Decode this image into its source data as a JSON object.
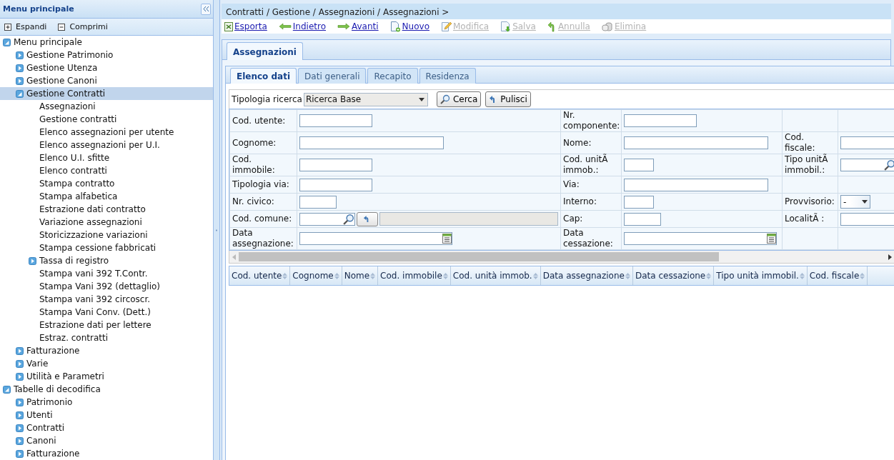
{
  "sidebar": {
    "title": "Menu principale",
    "actions": [
      {
        "label": "Espandi",
        "kind": "expand"
      },
      {
        "label": "Comprimi",
        "kind": "collapse"
      }
    ],
    "tree": [
      {
        "label": "Menu principale",
        "kind": "folder",
        "expanded": true,
        "selected": false,
        "children": [
          {
            "label": "Gestione Patrimonio",
            "kind": "folder",
            "expanded": false,
            "selected": false
          },
          {
            "label": "Gestione Utenza",
            "kind": "folder",
            "expanded": false,
            "selected": false
          },
          {
            "label": "Gestione Canoni",
            "kind": "folder",
            "expanded": false,
            "selected": false
          },
          {
            "label": "Gestione Contratti",
            "kind": "folder",
            "expanded": true,
            "selected": true,
            "children": [
              {
                "label": "Assegnazioni",
                "kind": "leaf",
                "selected": false
              },
              {
                "label": "Gestione contratti",
                "kind": "leaf",
                "selected": false
              },
              {
                "label": "Elenco assegnazioni per utente",
                "kind": "leaf",
                "selected": false
              },
              {
                "label": "Elenco assegnazioni per U.I.",
                "kind": "leaf",
                "selected": false
              },
              {
                "label": "Elenco U.I. sfitte",
                "kind": "leaf",
                "selected": false
              },
              {
                "label": "Elenco contratti",
                "kind": "leaf",
                "selected": false
              },
              {
                "label": "Stampa contratto",
                "kind": "leaf",
                "selected": false
              },
              {
                "label": "Stampa alfabetica",
                "kind": "leaf",
                "selected": false
              },
              {
                "label": "Estrazione dati contratto",
                "kind": "leaf",
                "selected": false
              },
              {
                "label": "Variazione assegnazioni",
                "kind": "leaf",
                "selected": false
              },
              {
                "label": "Storicizzazione variazioni",
                "kind": "leaf",
                "selected": false
              },
              {
                "label": "Stampa cessione fabbricati",
                "kind": "leaf",
                "selected": false
              },
              {
                "label": "Tassa di registro",
                "kind": "folder",
                "expanded": false,
                "selected": false
              },
              {
                "label": "Stampa vani 392 T.Contr.",
                "kind": "leaf",
                "selected": false
              },
              {
                "label": "Stampa Vani 392 (dettaglio)",
                "kind": "leaf",
                "selected": false
              },
              {
                "label": "Stampa vani 392 circoscr.",
                "kind": "leaf",
                "selected": false
              },
              {
                "label": "Stampa Vani Conv. (Dett.)",
                "kind": "leaf",
                "selected": false
              },
              {
                "label": "Estrazione dati per lettere",
                "kind": "leaf",
                "selected": false
              },
              {
                "label": "Estraz. contratti",
                "kind": "leaf",
                "selected": false
              }
            ]
          },
          {
            "label": "Fatturazione",
            "kind": "folder",
            "expanded": false,
            "selected": false
          },
          {
            "label": "Varie",
            "kind": "folder",
            "expanded": false,
            "selected": false
          },
          {
            "label": "Utilità e Parametri",
            "kind": "folder",
            "expanded": false,
            "selected": false
          }
        ]
      },
      {
        "label": "Tabelle di decodifica",
        "kind": "folder",
        "expanded": true,
        "selected": false,
        "children": [
          {
            "label": "Patrimonio",
            "kind": "folder",
            "expanded": false,
            "selected": false
          },
          {
            "label": "Utenti",
            "kind": "folder",
            "expanded": false,
            "selected": false
          },
          {
            "label": "Contratti",
            "kind": "folder",
            "expanded": false,
            "selected": false
          },
          {
            "label": "Canoni",
            "kind": "folder",
            "expanded": false,
            "selected": false
          },
          {
            "label": "Fatturazione",
            "kind": "folder",
            "expanded": false,
            "selected": false
          }
        ]
      }
    ]
  },
  "breadcrumb": "Contratti / Gestione / Assegnazioni / Assegnazioni >",
  "toolbar": [
    {
      "label": "Esporta",
      "kind": "export",
      "disabled": false
    },
    {
      "label": "Indietro",
      "kind": "back",
      "disabled": false
    },
    {
      "label": "Avanti",
      "kind": "forward",
      "disabled": false
    },
    {
      "label": "Nuovo",
      "kind": "new",
      "disabled": false
    },
    {
      "label": "Modifica",
      "kind": "edit",
      "disabled": true
    },
    {
      "label": "Salva",
      "kind": "save",
      "disabled": true
    },
    {
      "label": "Annulla",
      "kind": "undo",
      "disabled": true
    },
    {
      "label": "Elimina",
      "kind": "delete",
      "disabled": true
    }
  ],
  "tabs": [
    {
      "label": "Assegnazioni",
      "selected": true
    }
  ],
  "subtabs": [
    {
      "label": "Elenco dati",
      "selected": true
    },
    {
      "label": "Dati generali",
      "selected": false
    },
    {
      "label": "Recapito",
      "selected": false
    },
    {
      "label": "Residenza",
      "selected": false
    }
  ],
  "search": {
    "label": "Tipologia ricerca",
    "value": "Ricerca Base",
    "buttons": [
      {
        "label": "Cerca",
        "kind": "search"
      },
      {
        "label": "Pulisci",
        "kind": "clear"
      }
    ]
  },
  "form": {
    "rows": [
      [
        {
          "label": "Cod. utente:",
          "kind": "medium"
        },
        {
          "label": "Nr. componente:",
          "kind": "medium"
        }
      ],
      [
        {
          "label": "Cognome:",
          "kind": "long"
        },
        {
          "label": "Nome:",
          "kind": "long"
        },
        {
          "label": "Cod. fiscale:",
          "kind": "medium"
        }
      ],
      [
        {
          "label": "Cod. immobile:",
          "kind": "medium"
        },
        {
          "label": "Cod. unitÃ immob.:",
          "kind": "tiny"
        },
        {
          "label": "Tipo unitÃ immobil.:",
          "kind": "lookup"
        }
      ],
      [
        {
          "label": "Tipologia via:",
          "kind": "medium"
        },
        {
          "label": "Via:",
          "kind": "long"
        }
      ],
      [
        {
          "label": "Nr. civico:",
          "kind": "short"
        },
        {
          "label": "Interno:",
          "kind": "tiny"
        },
        {
          "label": "Provvisorio:",
          "kind": "select",
          "value": "-"
        }
      ],
      [
        {
          "label": "Cod. comune:",
          "kind": "lookup-desc"
        },
        {
          "label": "Cap:",
          "kind": "short"
        },
        {
          "label": "LocalitÃ :",
          "kind": "medium"
        }
      ],
      [
        {
          "label": "Data assegnazione:",
          "kind": "date"
        },
        {
          "label": "Data cessazione:",
          "kind": "date"
        }
      ]
    ]
  },
  "results": {
    "columns": [
      "Cod. utente",
      "Cognome",
      "Nome",
      "Cod. immobile",
      "Cod. unità immob.",
      "Data assegnazione",
      "Data cessazione",
      "Tipo unità immobil.",
      "Cod. fiscale"
    ]
  }
}
